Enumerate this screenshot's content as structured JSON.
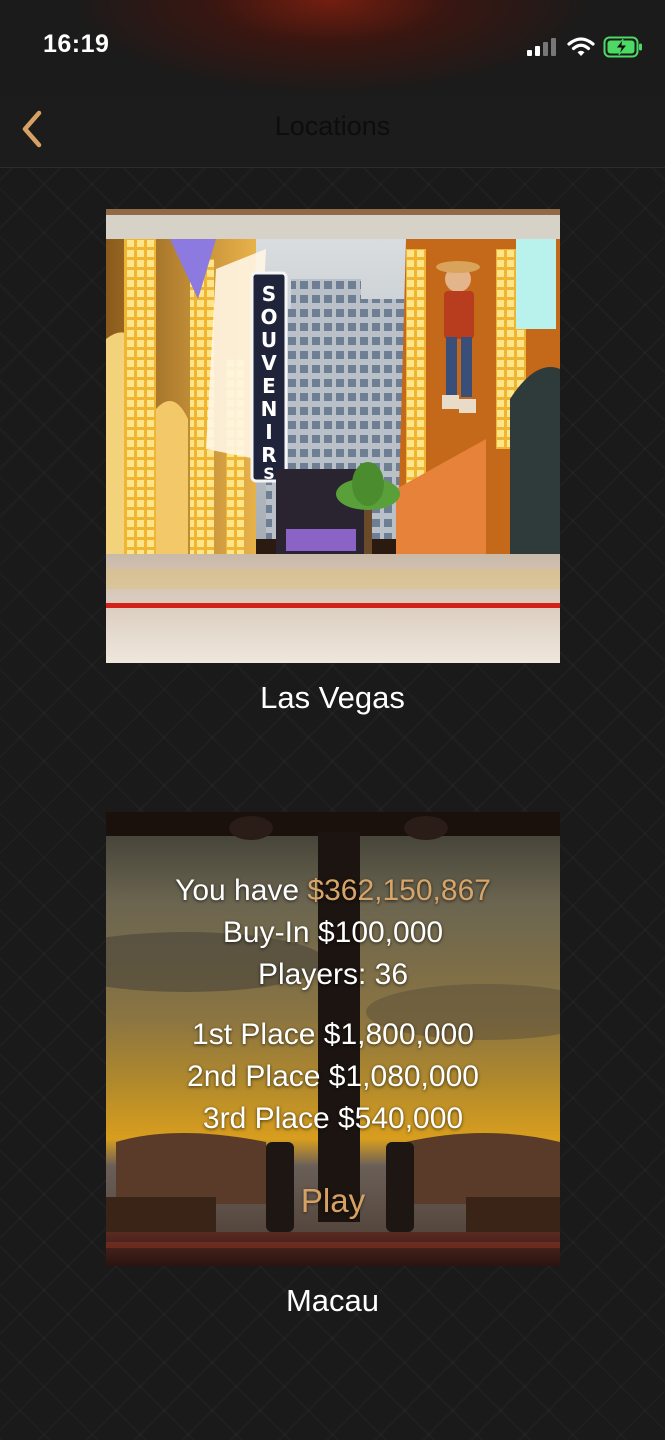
{
  "status_bar": {
    "time": "16:19",
    "icons": [
      "cellular-signal-icon",
      "wifi-icon",
      "battery-charging-icon"
    ]
  },
  "nav": {
    "title": "Locations",
    "back_icon": "chevron-left-icon",
    "accent": "#d6a163"
  },
  "locations": [
    {
      "name": "Las Vegas",
      "image": "las-vegas-casino-street-image"
    },
    {
      "name": "Macau",
      "image": "macau-restaurant-sunset-image",
      "balance_label": "You have",
      "balance_value": "$362,150,867",
      "buy_in": "Buy-In $100,000",
      "players": "Players: 36",
      "prizes": [
        "1st Place $1,800,000",
        "2nd Place $1,080,000",
        "3rd Place $540,000"
      ],
      "play_label": "Play"
    }
  ],
  "colors": {
    "background": "#1a1a1a",
    "money": "#d7a56a",
    "play": "#d6a163"
  }
}
